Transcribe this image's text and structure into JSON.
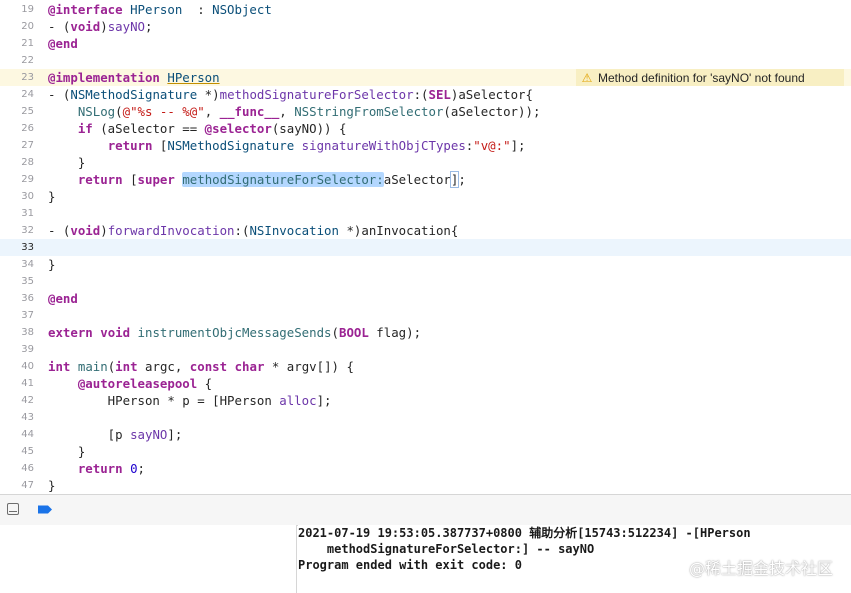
{
  "editor": {
    "lines": [
      {
        "n": "19",
        "seg": [
          [
            "kw",
            "@interface "
          ],
          [
            "ty",
            "HPerson"
          ],
          [
            "",
            "  : "
          ],
          [
            "ty",
            "NSObject"
          ]
        ]
      },
      {
        "n": "20",
        "seg": [
          [
            "",
            "- ("
          ],
          [
            "kw",
            "void"
          ],
          [
            "",
            ")"
          ],
          [
            "mt",
            "sayNO"
          ],
          [
            "",
            ";"
          ]
        ]
      },
      {
        "n": "21",
        "seg": [
          [
            "kw",
            "@end"
          ]
        ]
      },
      {
        "n": "22",
        "seg": []
      },
      {
        "n": "23",
        "warn": true,
        "seg": [
          [
            "kw",
            "@implementation "
          ],
          [
            "ul",
            "HPerson"
          ]
        ]
      },
      {
        "n": "24",
        "seg": [
          [
            "",
            "- ("
          ],
          [
            "ty",
            "NSMethodSignature"
          ],
          [
            "",
            " *)"
          ],
          [
            "mt",
            "methodSignatureForSelector"
          ],
          [
            "",
            ":("
          ],
          [
            "kw",
            "SEL"
          ],
          [
            "",
            ")aSelector{"
          ]
        ]
      },
      {
        "n": "25",
        "seg": [
          [
            "",
            "    "
          ],
          [
            "fn",
            "NSLog"
          ],
          [
            "",
            "("
          ],
          [
            "str",
            "@\"%s -- %@\""
          ],
          [
            "",
            ", "
          ],
          [
            "kw",
            "__func__"
          ],
          [
            "",
            ", "
          ],
          [
            "fn",
            "NSStringFromSelector"
          ],
          [
            "",
            "(aSelector));"
          ]
        ]
      },
      {
        "n": "26",
        "seg": [
          [
            "",
            "    "
          ],
          [
            "kw",
            "if"
          ],
          [
            "",
            " (aSelector == "
          ],
          [
            "kw",
            "@selector"
          ],
          [
            "",
            "(sayNO)) {"
          ]
        ]
      },
      {
        "n": "27",
        "seg": [
          [
            "",
            "        "
          ],
          [
            "kw",
            "return"
          ],
          [
            "",
            " ["
          ],
          [
            "ty",
            "NSMethodSignature"
          ],
          [
            "",
            " "
          ],
          [
            "mt",
            "signatureWithObjCTypes"
          ],
          [
            "",
            ":"
          ],
          [
            "str",
            "\"v@:\""
          ],
          [
            "",
            "];"
          ]
        ]
      },
      {
        "n": "28",
        "seg": [
          [
            "",
            "    }"
          ]
        ]
      },
      {
        "n": "29",
        "seg": [
          [
            "",
            "    "
          ],
          [
            "kw",
            "return"
          ],
          [
            "",
            " ["
          ],
          [
            "kw",
            "super"
          ],
          [
            "",
            " "
          ],
          [
            "sel",
            "methodSignatureForSelector:"
          ],
          [
            "",
            "aSelector"
          ],
          [
            "bracket",
            "]"
          ],
          [
            "",
            ";"
          ]
        ]
      },
      {
        "n": "30",
        "seg": [
          [
            "",
            "}"
          ]
        ]
      },
      {
        "n": "31",
        "seg": []
      },
      {
        "n": "32",
        "seg": [
          [
            "",
            "- ("
          ],
          [
            "kw",
            "void"
          ],
          [
            "",
            ")"
          ],
          [
            "mt",
            "forwardInvocation"
          ],
          [
            "",
            ":("
          ],
          [
            "ty",
            "NSInvocation"
          ],
          [
            "",
            " *)anInvocation{"
          ]
        ]
      },
      {
        "n": "33",
        "current": true,
        "seg": []
      },
      {
        "n": "34",
        "seg": [
          [
            "",
            "}"
          ]
        ]
      },
      {
        "n": "35",
        "seg": []
      },
      {
        "n": "36",
        "seg": [
          [
            "kw",
            "@end"
          ]
        ]
      },
      {
        "n": "37",
        "seg": []
      },
      {
        "n": "38",
        "seg": [
          [
            "kw",
            "extern"
          ],
          [
            "",
            " "
          ],
          [
            "kw",
            "void"
          ],
          [
            "",
            " "
          ],
          [
            "fn",
            "instrumentObjcMessageSends"
          ],
          [
            "",
            "("
          ],
          [
            "kw",
            "BOOL"
          ],
          [
            "",
            " flag);"
          ]
        ]
      },
      {
        "n": "39",
        "seg": []
      },
      {
        "n": "40",
        "seg": [
          [
            "kw",
            "int"
          ],
          [
            "",
            " "
          ],
          [
            "fn",
            "main"
          ],
          [
            "",
            "("
          ],
          [
            "kw",
            "int"
          ],
          [
            "",
            " argc, "
          ],
          [
            "kw",
            "const"
          ],
          [
            "",
            " "
          ],
          [
            "kw",
            "char"
          ],
          [
            "",
            " * argv[]) {"
          ]
        ]
      },
      {
        "n": "41",
        "seg": [
          [
            "",
            "    "
          ],
          [
            "kw",
            "@autoreleasepool"
          ],
          [
            "",
            " {"
          ]
        ]
      },
      {
        "n": "42",
        "seg": [
          [
            "",
            "        HPerson * p = [HPerson "
          ],
          [
            "mt",
            "alloc"
          ],
          [
            "",
            "];"
          ]
        ]
      },
      {
        "n": "43",
        "seg": []
      },
      {
        "n": "44",
        "seg": [
          [
            "",
            "        [p "
          ],
          [
            "mt",
            "sayNO"
          ],
          [
            "",
            "];"
          ]
        ]
      },
      {
        "n": "45",
        "seg": [
          [
            "",
            "    }"
          ]
        ]
      },
      {
        "n": "46",
        "seg": [
          [
            "",
            "    "
          ],
          [
            "kw",
            "return"
          ],
          [
            "",
            " "
          ],
          [
            "num",
            "0"
          ],
          [
            "",
            ";"
          ]
        ]
      },
      {
        "n": "47",
        "seg": [
          [
            "",
            "}"
          ]
        ]
      }
    ]
  },
  "warning": {
    "icon": "warning-triangle-icon",
    "text": "Method definition for 'sayNO' not found",
    "color": "#f8efc3"
  },
  "debug_bar": {
    "toggle_icon": "hide-debug-area-icon",
    "breakpoint_icon": "breakpoint-icon",
    "accent": "#1a73e8"
  },
  "console": {
    "lines": [
      "2021-07-19 19:53:05.387737+0800 辅助分析[15743:512234] -[HPerson",
      "    methodSignatureForSelector:] -- sayNO",
      "Program ended with exit code: 0"
    ]
  },
  "watermark": "@稀土掘金技术社区"
}
